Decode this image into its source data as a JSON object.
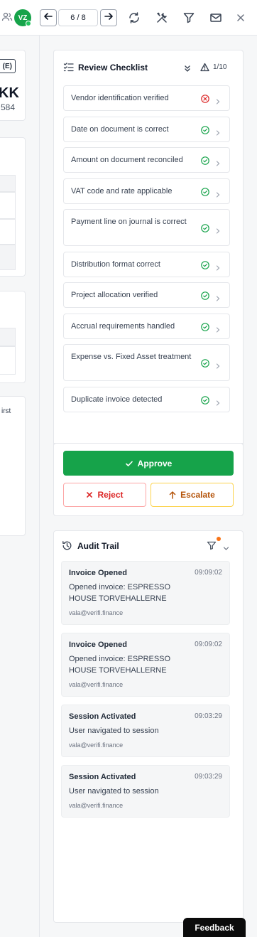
{
  "topbar": {
    "avatar_initials": "VZ",
    "pager": "6 / 8",
    "icons": [
      "users-icon",
      "arrow-left-icon",
      "arrow-right-icon",
      "refresh-icon",
      "tools-icon",
      "filter-icon",
      "mail-icon",
      "close-icon"
    ]
  },
  "left_panel": {
    "badge_text": "(E)",
    "big_text": "KK",
    "number_text": "584",
    "first_text": "irst"
  },
  "checklist": {
    "title": "Review Checklist",
    "count": "1/10",
    "items": [
      {
        "label": "Vendor identification verified",
        "status": "fail"
      },
      {
        "label": "Date on document is correct",
        "status": "pass"
      },
      {
        "label": "Amount on document reconciled",
        "status": "pass"
      },
      {
        "label": "VAT code and rate applicable",
        "status": "pass"
      },
      {
        "label": "Payment line on journal is correct",
        "status": "pass"
      },
      {
        "label": "Distribution format correct",
        "status": "pass"
      },
      {
        "label": "Project allocation verified",
        "status": "pass"
      },
      {
        "label": "Accrual requirements handled",
        "status": "pass"
      },
      {
        "label": "Expense vs. Fixed Asset treatment",
        "status": "pass"
      },
      {
        "label": "Duplicate invoice detected",
        "status": "pass"
      }
    ],
    "approve_label": "Approve",
    "reject_label": "Reject",
    "escalate_label": "Escalate"
  },
  "audit": {
    "title": "Audit Trail",
    "entries": [
      {
        "title": "Invoice Opened",
        "time": "09:09:02",
        "desc": "Opened invoice: ESPRESSO HOUSE TORVEHALLERNE",
        "user": "vala@verifi.finance"
      },
      {
        "title": "Invoice Opened",
        "time": "09:09:02",
        "desc": "Opened invoice: ESPRESSO HOUSE TORVEHALLERNE",
        "user": "vala@verifi.finance"
      },
      {
        "title": "Session Activated",
        "time": "09:03:29",
        "desc": "User navigated to session",
        "user": "vala@verifi.finance"
      },
      {
        "title": "Session Activated",
        "time": "09:03:29",
        "desc": "User navigated to session",
        "user": "vala@verifi.finance"
      }
    ]
  },
  "feedback_label": "Feedback",
  "colors": {
    "approve": "#16a34a",
    "reject": "#dc2626",
    "escalate": "#b45309",
    "pass": "#16a34a",
    "fail": "#dc2626",
    "filter_dot": "#f97316"
  }
}
